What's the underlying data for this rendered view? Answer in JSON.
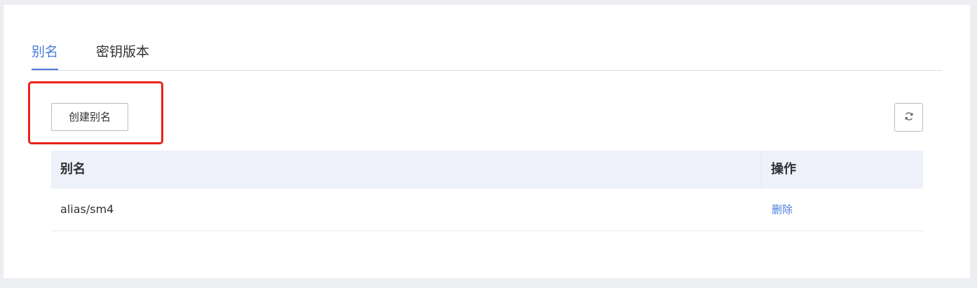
{
  "tabs": [
    {
      "label": "别名",
      "active": true
    },
    {
      "label": "密钥版本",
      "active": false
    }
  ],
  "toolbar": {
    "create_label": "创建别名",
    "refresh_icon": "refresh-icon"
  },
  "table": {
    "columns": [
      "别名",
      "操作"
    ],
    "rows": [
      {
        "alias": "alias/sm4",
        "action": "删除"
      }
    ]
  },
  "colors": {
    "accent": "#4a7bd8",
    "highlight": "#e8231a",
    "header_bg": "#eef1fa"
  }
}
